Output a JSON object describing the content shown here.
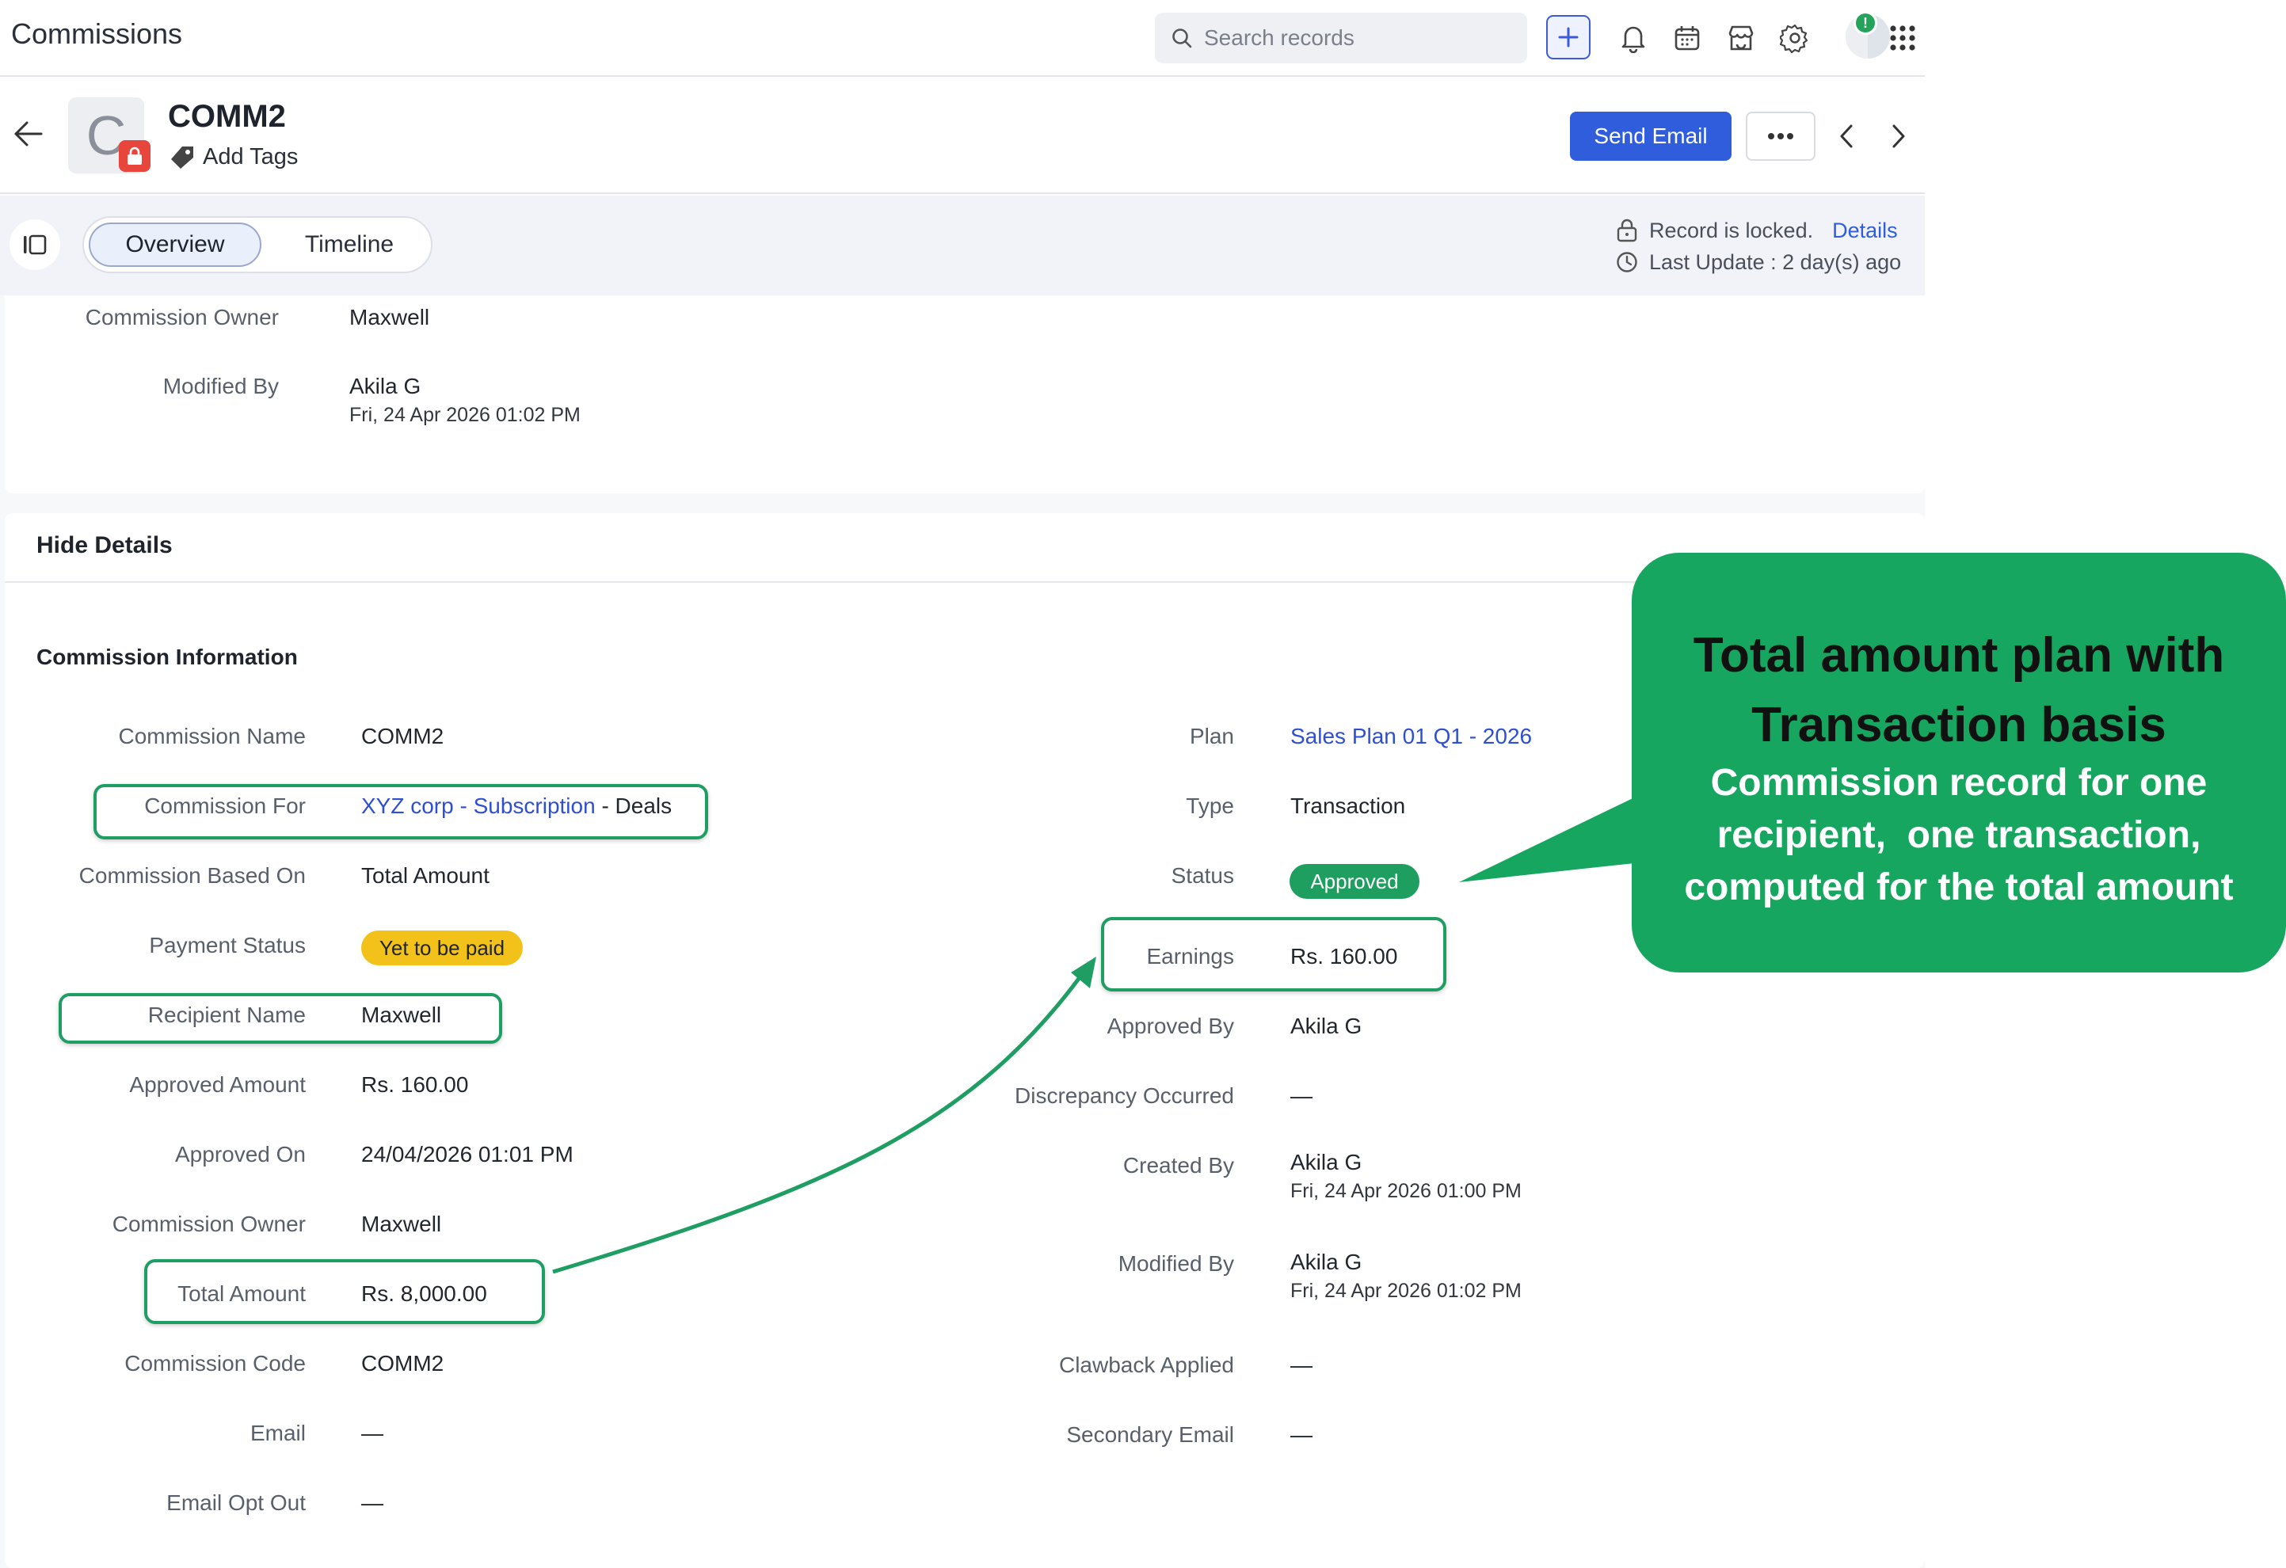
{
  "app": {
    "title": "Commissions"
  },
  "search": {
    "placeholder": "Search records"
  },
  "notifications": {
    "badge": "!"
  },
  "record": {
    "avatar_letter": "C",
    "name": "COMM2",
    "add_tags_label": "Add Tags",
    "send_email_label": "Send Email"
  },
  "tabs": {
    "overview": "Overview",
    "timeline": "Timeline"
  },
  "lock_info": {
    "locked_text": "Record is locked.",
    "details_link": "Details",
    "last_update": "Last Update : 2 day(s) ago"
  },
  "top_fields": {
    "owner_label": "Commission Owner",
    "owner_value": "Maxwell",
    "modified_label": "Modified By",
    "modified_name": "Akila G",
    "modified_time": "Fri, 24 Apr 2026 01:02 PM"
  },
  "hide_details_label": "Hide Details",
  "section_title": "Commission Information",
  "left_fields": {
    "commission_name": {
      "label": "Commission Name",
      "value": "COMM2"
    },
    "commission_for": {
      "label": "Commission For",
      "link": "XYZ corp - Subscription",
      "suffix": " - Deals"
    },
    "based_on": {
      "label": "Commission Based On",
      "value": "Total Amount"
    },
    "payment_status": {
      "label": "Payment Status",
      "value": "Yet to be paid"
    },
    "recipient": {
      "label": "Recipient Name",
      "value": "Maxwell"
    },
    "approved_amount": {
      "label": "Approved Amount",
      "value": "Rs. 160.00"
    },
    "approved_on": {
      "label": "Approved On",
      "value": "24/04/2026 01:01 PM"
    },
    "owner": {
      "label": "Commission Owner",
      "value": "Maxwell"
    },
    "total_amount": {
      "label": "Total Amount",
      "value": "Rs. 8,000.00"
    },
    "code": {
      "label": "Commission Code",
      "value": "COMM2"
    },
    "email": {
      "label": "Email",
      "value": "—"
    },
    "email_opt_out": {
      "label": "Email Opt Out",
      "value": "—"
    }
  },
  "right_fields": {
    "plan": {
      "label": "Plan",
      "value": "Sales Plan 01 Q1 - 2026"
    },
    "type": {
      "label": "Type",
      "value": "Transaction"
    },
    "status": {
      "label": "Status",
      "value": "Approved"
    },
    "earnings": {
      "label": "Earnings",
      "value": "Rs. 160.00"
    },
    "approved_by": {
      "label": "Approved By",
      "value": "Akila G"
    },
    "discrepancy": {
      "label": "Discrepancy Occurred",
      "value": "—"
    },
    "created_by": {
      "label": "Created By",
      "name": "Akila G",
      "time": "Fri, 24 Apr 2026 01:00 PM"
    },
    "modified_by": {
      "label": "Modified By",
      "name": "Akila G",
      "time": "Fri, 24 Apr 2026 01:02 PM"
    },
    "clawback": {
      "label": "Clawback Applied",
      "value": "—"
    },
    "secondary_email": {
      "label": "Secondary Email",
      "value": "—"
    }
  },
  "callout": {
    "title_line1": "Total amount plan with",
    "title_line2": "Transaction basis",
    "sub_line1": "Commission record for one",
    "sub_line2": "recipient,  one transaction,",
    "sub_line3": "computed for the total amount"
  },
  "colors": {
    "primary_blue": "#2f5ddb",
    "link_blue": "#2f4fd2",
    "approved_green": "#1e9e5f",
    "callout_green": "#17a660",
    "highlight_green": "#1f9e63",
    "payment_yellow": "#f3c21a",
    "lock_red": "#e8453c"
  }
}
